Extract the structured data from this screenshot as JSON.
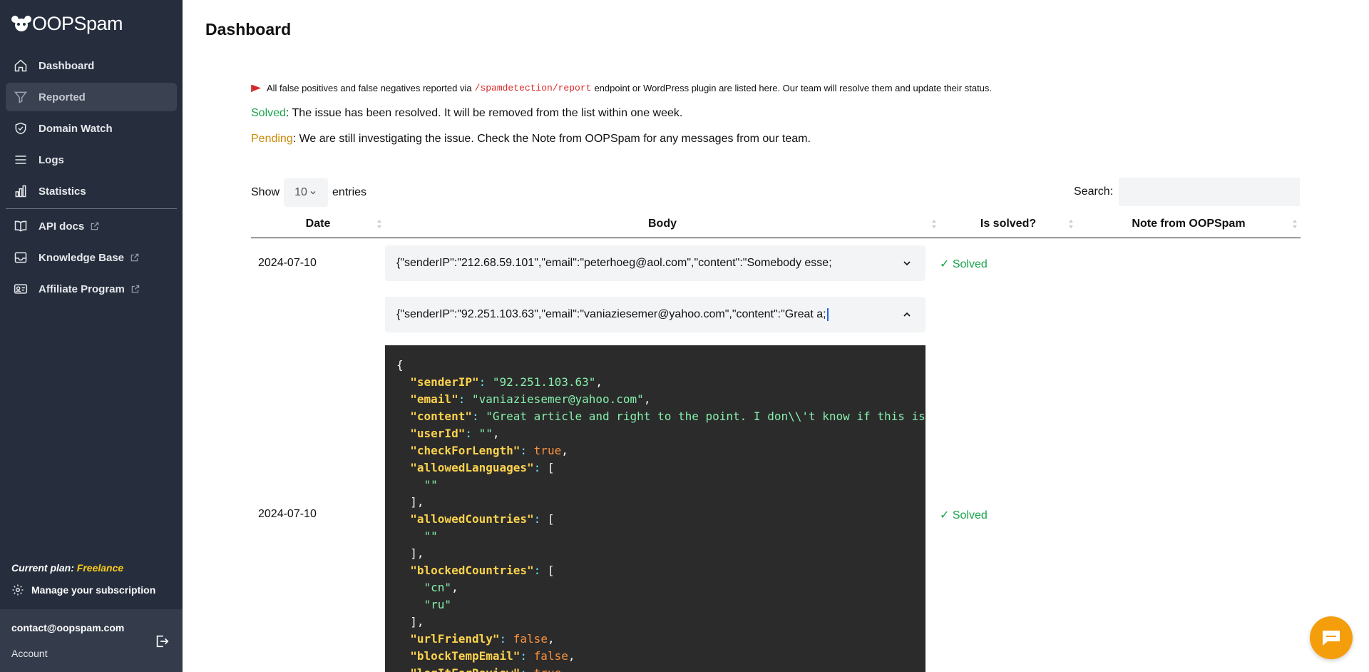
{
  "app": {
    "logo_text": "OOPSpam"
  },
  "sidebar": {
    "items": [
      {
        "label": "Dashboard",
        "icon": "home-icon"
      },
      {
        "label": "Reported",
        "icon": "filter-icon",
        "active": true
      },
      {
        "label": "Domain Watch",
        "icon": "shield-check-icon"
      },
      {
        "label": "Logs",
        "icon": "list-icon"
      },
      {
        "label": "Statistics",
        "icon": "bar-chart-icon"
      },
      {
        "label": "API docs",
        "icon": "book-icon",
        "external": true
      },
      {
        "label": "Knowledge Base",
        "icon": "inbox-icon",
        "external": true
      },
      {
        "label": "Affiliate Program",
        "icon": "id-card-icon",
        "external": true
      }
    ],
    "plan_label": "Current plan:",
    "plan_value": "Freelance",
    "manage_label": "Manage your subscription",
    "email": "contact@oopspam.com",
    "account_label": "Account"
  },
  "page": {
    "title": "Dashboard",
    "info_prefix": "All false positives and false negatives reported via",
    "info_code": "/spamdetection/report",
    "info_suffix": "endpoint or WordPress plugin are listed here. Our team will resolve them and update their status.",
    "solved_word": "Solved",
    "solved_desc": ": The issue has been resolved. It will be removed from the list within one week.",
    "pending_word": "Pending",
    "pending_desc": ": We are still investigating the issue. Check the Note from OOPSpam for any messages from our team."
  },
  "table": {
    "show_label": "Show",
    "entries_value": "10",
    "entries_label": "entries",
    "search_label": "Search:",
    "search_value": "",
    "columns": [
      "Date",
      "Body",
      "Is solved?",
      "Note from OOPSpam"
    ],
    "rows": [
      {
        "date": "2024-07-10",
        "body": "{\"senderIP\":\"212.68.59.101\",\"email\":\"peterhoeg@aol.com\",\"content\":\"Somebody esse;",
        "status": "✓ Solved",
        "note": ""
      },
      {
        "date": "2024-07-10",
        "body": "{\"senderIP\":\"92.251.103.63\",\"email\":\"vaniaziesemer@yahoo.com\",\"content\":\"Great a;",
        "status": "✓ Solved",
        "note": ""
      }
    ]
  },
  "code_view": {
    "sender_ip": "\"92.251.103.63\"",
    "email": "\"vaniaziesemer@yahoo.com\"",
    "content": "\"Great article and right to the point. I don\\\\'t know if this is",
    "user_id": "\"\"",
    "check_for_length": "true",
    "allowed_languages_item": "\"\"",
    "allowed_countries_item": "\"\"",
    "blocked_country_1": "\"cn\"",
    "blocked_country_2": "\"ru\"",
    "url_friendly": "false",
    "block_temp_email": "false"
  },
  "colors": {
    "sidebar_bg": "#262e3d",
    "solved": "#16a34a",
    "pending": "#ca8a04",
    "code_bg": "#2b2b2b",
    "chat_button": "#f59e0b"
  }
}
